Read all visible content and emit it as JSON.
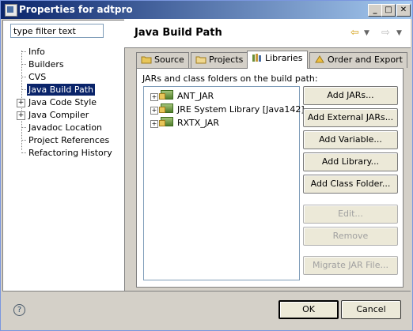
{
  "window": {
    "title": "Properties for adtpro"
  },
  "filter": {
    "placeholder": "type filter text",
    "value": "type filter text"
  },
  "sidebar": {
    "items": [
      {
        "label": "Info",
        "expandable": false
      },
      {
        "label": "Builders",
        "expandable": false
      },
      {
        "label": "CVS",
        "expandable": false
      },
      {
        "label": "Java Build Path",
        "expandable": false,
        "selected": true
      },
      {
        "label": "Java Code Style",
        "expandable": true
      },
      {
        "label": "Java Compiler",
        "expandable": true
      },
      {
        "label": "Javadoc Location",
        "expandable": false
      },
      {
        "label": "Project References",
        "expandable": false
      },
      {
        "label": "Refactoring History",
        "expandable": false
      }
    ]
  },
  "header": {
    "title": "Java Build Path"
  },
  "tabs": [
    {
      "label": "Source",
      "icon": "source-folder-icon"
    },
    {
      "label": "Projects",
      "icon": "projects-icon"
    },
    {
      "label": "Libraries",
      "icon": "libraries-icon",
      "active": true
    },
    {
      "label": "Order and Export",
      "icon": "order-export-icon"
    }
  ],
  "libraries": {
    "label": "JARs and class folders on the build path:",
    "items": [
      {
        "label": "ANT_JAR"
      },
      {
        "label": "JRE System Library [Java142]"
      },
      {
        "label": "RXTX_JAR"
      }
    ]
  },
  "buttons": {
    "add_jars": "Add JARs...",
    "add_external_jars": "Add External JARs...",
    "add_variable": "Add Variable...",
    "add_library": "Add Library...",
    "add_class_folder": "Add Class Folder...",
    "edit": "Edit...",
    "remove": "Remove",
    "migrate_jar": "Migrate JAR File..."
  },
  "footer": {
    "ok": "OK",
    "cancel": "Cancel",
    "help": "?"
  },
  "colors": {
    "selection": "#0a246a",
    "title_start": "#0a246a",
    "title_end": "#a6caf0"
  }
}
